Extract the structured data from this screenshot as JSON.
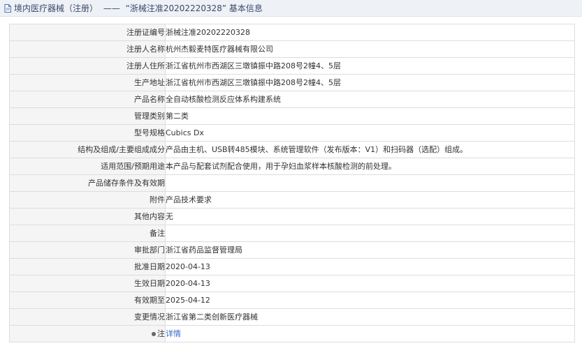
{
  "header": {
    "title_part1": "境内医疗器械（注册）",
    "title_dash": "——",
    "title_part2": "“浙械注准20202220328” 基本信息",
    "icon": "document-icon"
  },
  "rows": [
    {
      "label": "注册证编号",
      "value": "浙械注准20202220328"
    },
    {
      "label": "注册人名称",
      "value": "杭州杰毅麦特医疗器械有限公司"
    },
    {
      "label": "注册人住所",
      "value": "浙江省杭州市西湖区三墩镇振中路208号2幢4、5层"
    },
    {
      "label": "生产地址",
      "value": "浙江省杭州市西湖区三墩镇振中路208号2幢4、5层"
    },
    {
      "label": "产品名称",
      "value": "全自动核酸检测反应体系构建系统"
    },
    {
      "label": "管理类别",
      "value": "第二类"
    },
    {
      "label": "型号规格",
      "value": "Cubics Dx"
    },
    {
      "label": "结构及组成/主要组成成分",
      "value": "产品由主机、USB转485模块、系统管理软件（发布版本：V1）和扫码器（选配）组成。"
    },
    {
      "label": "适用范围/预期用途",
      "value": "本产品与配套试剂配合使用，用于孕妇血浆样本核酸检测的前处理。"
    },
    {
      "label": "产品储存条件及有效期",
      "value": ""
    },
    {
      "label": "附件",
      "value": "产品技术要求"
    },
    {
      "label": "其他内容",
      "value": "无"
    },
    {
      "label": "备注",
      "value": ""
    },
    {
      "label": "审批部门",
      "value": "浙江省药品监督管理局"
    },
    {
      "label": "批准日期",
      "value": "2020-04-13"
    },
    {
      "label": "生效日期",
      "value": "2020-04-13"
    },
    {
      "label": "有效期至",
      "value": "2025-04-12"
    },
    {
      "label": "变更情况",
      "value": "浙江省第二类创新医疗器械"
    }
  ],
  "note_row": {
    "label": "注",
    "link_text": "详情",
    "icon": "dot-icon"
  }
}
